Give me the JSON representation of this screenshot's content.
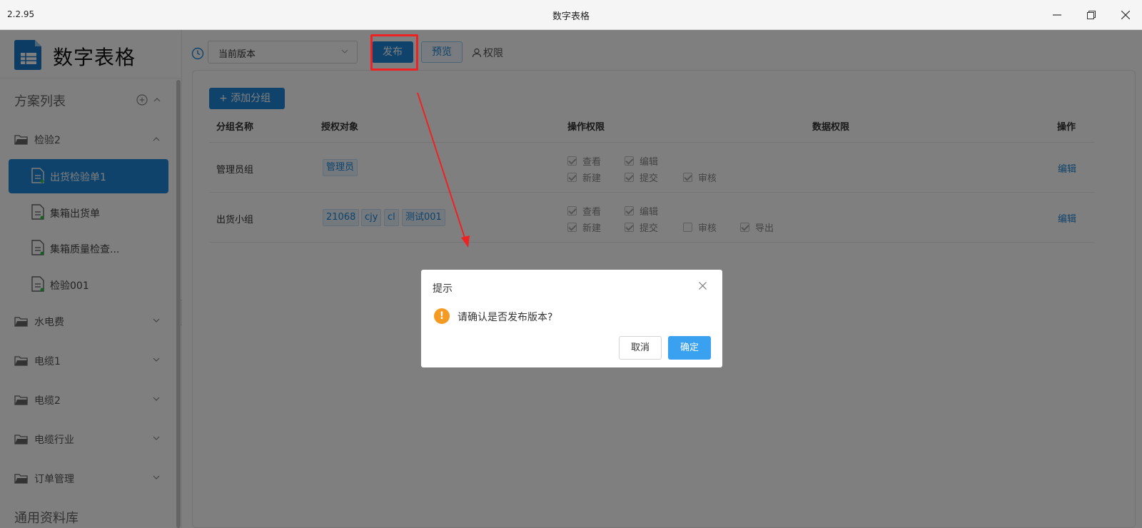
{
  "window": {
    "version": "2.2.95",
    "title": "数字表格",
    "controls": {
      "minimize": "minimize-icon",
      "restore": "restore-icon",
      "close": "close-icon"
    }
  },
  "sidebar": {
    "brand_name": "数字表格",
    "section_title": "方案列表",
    "groups": [
      {
        "label": "检验2",
        "expanded": true
      },
      {
        "label": "水电费",
        "expanded": false
      },
      {
        "label": "电缆1",
        "expanded": false
      },
      {
        "label": "电缆2",
        "expanded": false
      },
      {
        "label": "电缆行业",
        "expanded": false
      },
      {
        "label": "订单管理",
        "expanded": false
      },
      {
        "label": "通用资料库",
        "expanded": false
      }
    ],
    "items": [
      {
        "label": "出货检验单1",
        "active": true
      },
      {
        "label": "集箱出货单",
        "active": false
      },
      {
        "label": "集箱质量检查...",
        "active": false
      },
      {
        "label": "检验001",
        "active": false
      }
    ]
  },
  "toolbar": {
    "version_select_value": "当前版本",
    "publish_label": "发布",
    "preview_label": "预览",
    "permission_label": "权限"
  },
  "panel": {
    "add_group_label": "添加分组",
    "columns": [
      "分组名称",
      "授权对象",
      "操作权限",
      "数据权限",
      "操作"
    ],
    "rows": [
      {
        "name": "管理员组",
        "subjects": [
          "管理员"
        ],
        "permissions": [
          {
            "label": "查看",
            "checked": true
          },
          {
            "label": "编辑",
            "checked": true
          },
          {
            "label": "新建",
            "checked": true
          },
          {
            "label": "提交",
            "checked": true
          },
          {
            "label": "审核",
            "checked": true
          }
        ],
        "action": "编辑"
      },
      {
        "name": "出货小组",
        "subjects": [
          "21068",
          "cjy",
          "cl",
          "测试001"
        ],
        "permissions": [
          {
            "label": "查看",
            "checked": true
          },
          {
            "label": "编辑",
            "checked": true
          },
          {
            "label": "新建",
            "checked": true
          },
          {
            "label": "提交",
            "checked": true
          },
          {
            "label": "审核",
            "checked": false
          },
          {
            "label": "导出",
            "checked": true
          }
        ],
        "action": "编辑"
      }
    ]
  },
  "dialog": {
    "title": "提示",
    "message": "请确认是否发布版本?",
    "cancel_label": "取消",
    "confirm_label": "确定",
    "icon": "warning-icon"
  },
  "colors": {
    "primary": "#1f86d6",
    "dialog_confirm": "#3aa1f1",
    "highlight": "#ee2222",
    "warning": "#f59a23"
  }
}
